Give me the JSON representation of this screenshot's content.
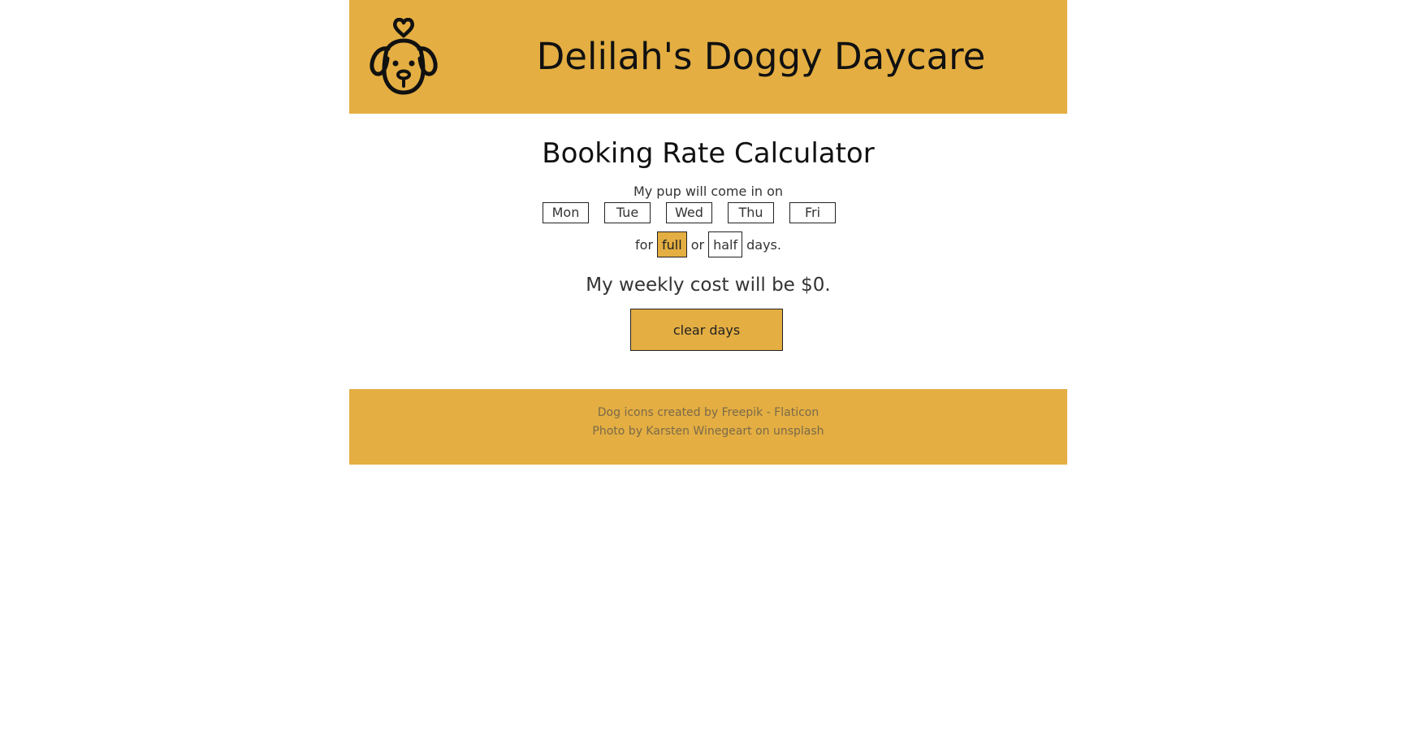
{
  "header": {
    "title": "Delilah's Doggy Daycare",
    "logo_icon": "dog-heart-icon"
  },
  "calculator": {
    "title": "Booking Rate Calculator",
    "intro": "My pup will come in on",
    "days": [
      "Mon",
      "Tue",
      "Wed",
      "Thu",
      "Fri"
    ],
    "rate_prefix": "for",
    "full_label": "full",
    "or_text": "or",
    "half_label": "half",
    "rate_suffix": "days.",
    "selected_rate": "full",
    "cost_text": "My weekly cost will be $0.",
    "clear_label": "clear days"
  },
  "footer": {
    "credit_icons": "Dog icons created by Freepik - Flaticon",
    "credit_photo": "Photo by Karsten Winegeart on unsplash"
  },
  "colors": {
    "accent": "#e4ae42",
    "text": "#222222",
    "background": "#ffffff"
  }
}
